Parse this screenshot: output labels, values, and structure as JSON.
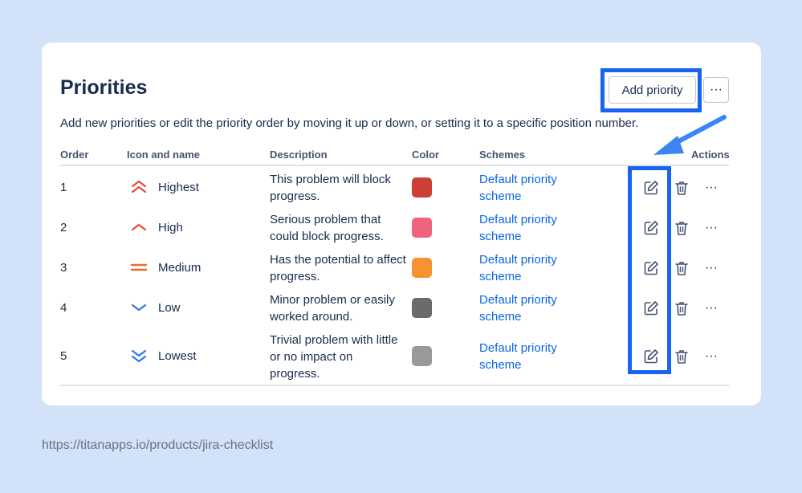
{
  "header": {
    "title": "Priorities",
    "subtitle": "Add new priorities or edit the priority order by moving it up or down, or setting it to a specific position number.",
    "add_label": "Add priority",
    "more_label": "···"
  },
  "columns": {
    "order": "Order",
    "icon_name": "Icon and name",
    "description": "Description",
    "color": "Color",
    "schemes": "Schemes",
    "actions": "Actions"
  },
  "rows": [
    {
      "order": "1",
      "icon": "chevrons-up-double",
      "name": "Highest",
      "description": "This problem will block progress.",
      "color": "#cd3f35",
      "scheme": "Default priority scheme"
    },
    {
      "order": "2",
      "icon": "chevron-up",
      "name": "High",
      "description": "Serious problem that could block progress.",
      "color": "#f0637d",
      "scheme": "Default priority scheme"
    },
    {
      "order": "3",
      "icon": "equals",
      "name": "Medium",
      "description": "Has the potential to affect progress.",
      "color": "#f79232",
      "scheme": "Default priority scheme"
    },
    {
      "order": "4",
      "icon": "chevron-down",
      "name": "Low",
      "description": "Minor problem or easily worked around.",
      "color": "#6b6b6b",
      "scheme": "Default priority scheme"
    },
    {
      "order": "5",
      "icon": "chevrons-down-double",
      "name": "Lowest",
      "description": "Trivial problem with little or no impact on progress.",
      "color": "#999999",
      "scheme": "Default priority scheme"
    }
  ],
  "row_action_more": "···",
  "footer_url": "https://titanapps.io/products/jira-checklist",
  "colors": {
    "link": "#0c66e4",
    "highlight": "#1764f0",
    "background": "#d2e2f9"
  }
}
